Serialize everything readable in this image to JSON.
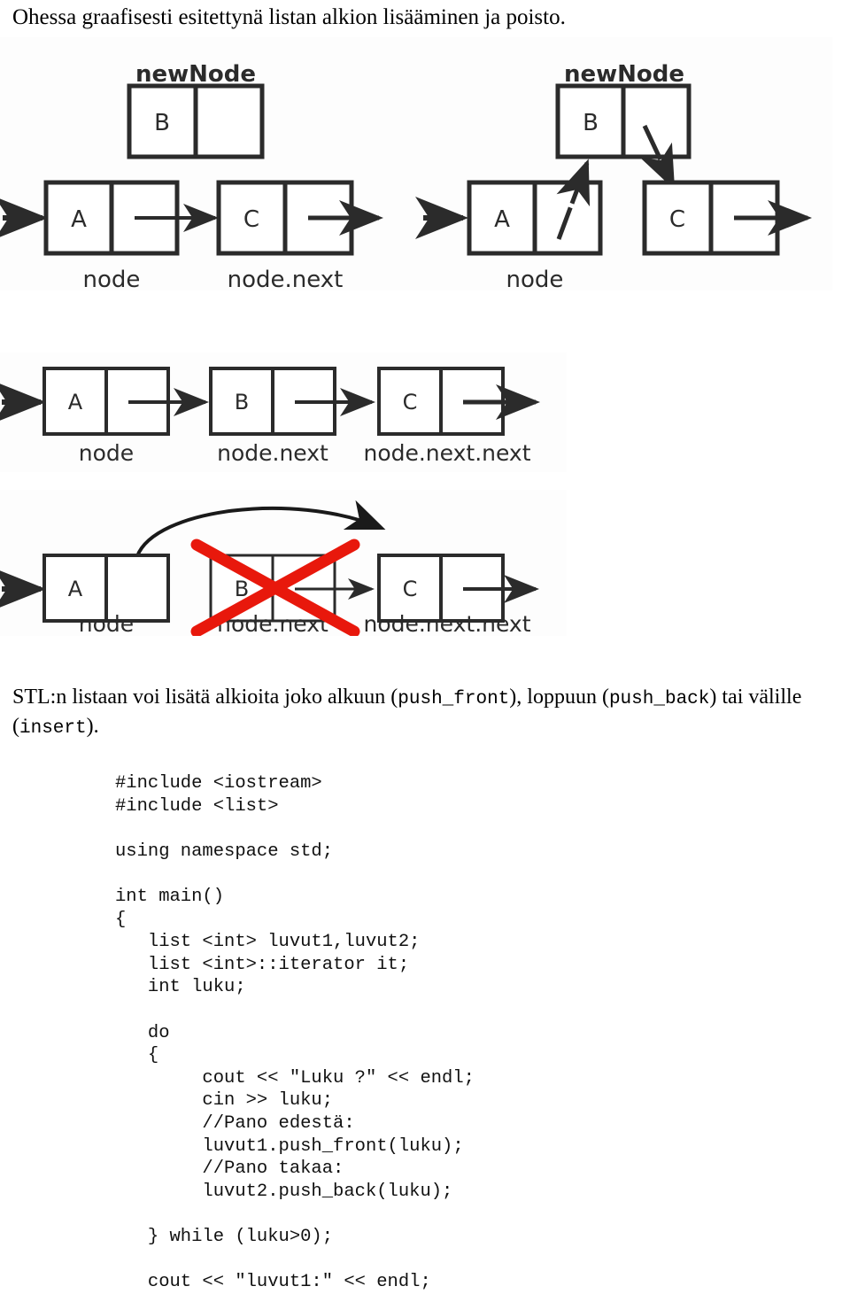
{
  "document": {
    "intro_text": "Ohessa graafisesti esitettynä listan alkion lisääminen ja poisto.",
    "body_paragraph": {
      "part1": "STL:n listaan voi lisätä alkioita joko alkuun (",
      "code1": "push_front",
      "part2": "), loppuun  (",
      "code2": "push_back",
      "part3": ")",
      "part4": "tai välille (",
      "code3": "insert",
      "part5": ")."
    }
  },
  "figures": {
    "insert_before": {
      "new_node_label": "newNode",
      "new_node_value": "B",
      "node_a_value": "A",
      "node_a_label": "node",
      "node_c_value": "C",
      "node_c_label": "node.next"
    },
    "insert_after": {
      "new_node_label": "newNode",
      "new_node_value": "B",
      "node_a_value": "A",
      "node_a_label": "node",
      "node_c_value": "C"
    },
    "list_three": {
      "node_a_value": "A",
      "node_a_label": "node",
      "node_b_value": "B",
      "node_b_label": "node.next",
      "node_c_value": "C",
      "node_c_label": "node.next.next"
    },
    "list_delete": {
      "node_a_value": "A",
      "node_a_label": "node",
      "node_b_value": "B",
      "node_b_label": "node.next",
      "node_c_value": "C",
      "node_c_label": "node.next.next",
      "deleted_marker": "red-cross"
    }
  },
  "code": {
    "lines": [
      "#include <iostream>",
      "#include <list>",
      "",
      "using namespace std;",
      "",
      "int main()",
      "{",
      "   list <int> luvut1,luvut2;",
      "   list <int>::iterator it;",
      "   int luku;",
      "",
      "   do",
      "   {",
      "        cout << \"Luku ?\" << endl;",
      "        cin >> luku;",
      "        //Pano edestä:",
      "        luvut1.push_front(luku);",
      "        //Pano takaa:",
      "        luvut2.push_back(luku);",
      "",
      "   } while (luku>0);",
      "",
      "   cout << \"luvut1:\" << endl;"
    ]
  },
  "colors": {
    "ink": "#2b2b2b",
    "delete_red": "#e8180c",
    "text": "#000000"
  }
}
